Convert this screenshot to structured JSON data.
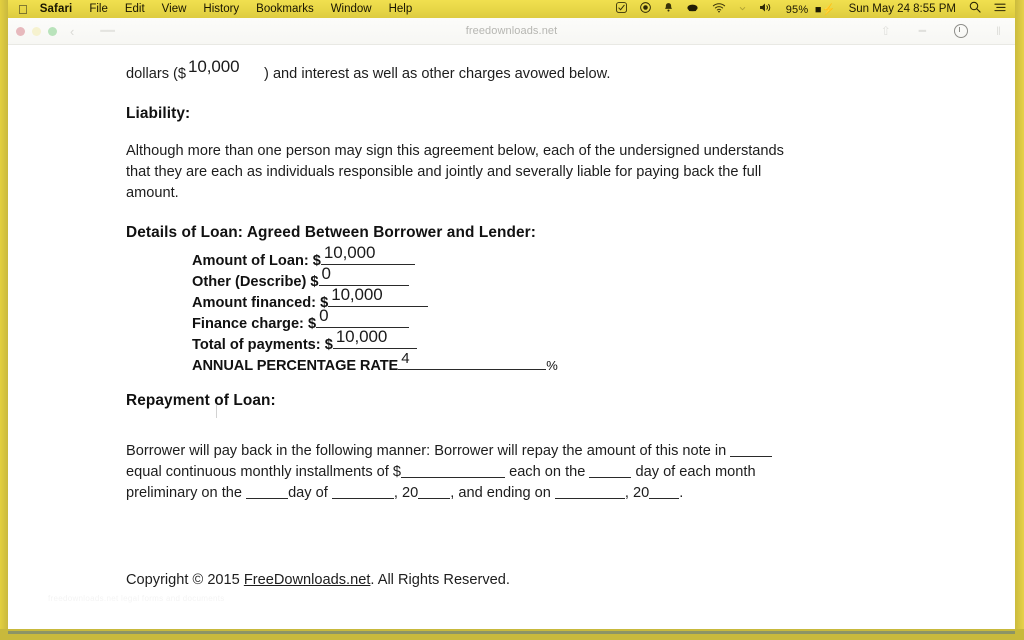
{
  "menubar": {
    "apple_icon": "apple-icon",
    "items": [
      {
        "label": "Safari",
        "bold": true
      },
      {
        "label": "File",
        "bold": false
      },
      {
        "label": "Edit",
        "bold": false
      },
      {
        "label": "View",
        "bold": false
      },
      {
        "label": "History",
        "bold": false
      },
      {
        "label": "Bookmarks",
        "bold": false
      },
      {
        "label": "Window",
        "bold": false
      },
      {
        "label": "Help",
        "bold": false
      }
    ],
    "status_icons": [
      "checkbox-checked-icon",
      "record-dot-icon",
      "bell-icon",
      "dropbox-icon",
      "wifi-icon",
      "chevron-small-icon",
      "volume-icon"
    ],
    "battery": "95%",
    "battery_icon": "battery-charging-icon",
    "clock": "Sun May 24  8:55 PM",
    "search_icon": "search-icon",
    "notification_center_icon": "list-lines-icon"
  },
  "browser": {
    "window_title": "freedownloads.net",
    "traffic_lights": [
      "close-button",
      "minimize-button",
      "zoom-button"
    ],
    "back_icon": "back-arrow-icon",
    "share_icon": "share-icon",
    "tabs_icon": "show-tabs-icon",
    "settings_icon": "gear-icon"
  },
  "document": {
    "line_top": "dollars ($__________) and interest as well as other charges avowed below.",
    "line_top_filled": "10,000",
    "liability_heading": "Liability:",
    "liability_body_lines": [
      "Although more than one person may sign this agreement below, each of the undersigned understands",
      "that they are each as individuals responsible and jointly and severally liable for paying back the full",
      "amount."
    ],
    "details_heading": "Details of Loan: Agreed Between Borrower and Lender:",
    "fields": [
      {
        "label": "Amount of Loan: $",
        "value": "10,000"
      },
      {
        "label": "Other (Describe) $",
        "value": "0"
      },
      {
        "label": "Amount financed: $",
        "value": "10,000"
      },
      {
        "label": "Finance charge: $",
        "value": "0"
      },
      {
        "label": "Total of payments: $",
        "value": "10,000"
      }
    ],
    "apr_label": "ANNUAL PERCENTAGE RATE",
    "apr_value": "4",
    "apr_suffix": "%",
    "repayment_heading": "Repayment of Loan:",
    "repayment_line1_a": "Borrower will pay back in the following manner: Borrower will repay the amount of this note in",
    "repayment_line2_a": "equal continuous monthly installments of $",
    "repayment_line2_b": "each on the",
    "repayment_line2_c": "day of each month",
    "repayment_line3_a": "preliminary on the",
    "repayment_line3_b": "day of",
    "repayment_line3_c": ", 20",
    "repayment_line3_d": ", and ending on",
    "repayment_line3_e": ", 20",
    "repayment_line3_f": ".",
    "copyright_prefix": "Copyright © 2015 ",
    "copyright_link": "FreeDownloads.net",
    "copyright_suffix": ". All Rights Reserved.",
    "watermark": "freedownloads.net legal forms and documents"
  },
  "colors": {
    "frame": "#ddcb40",
    "menubar": "#e7d646",
    "page": "#ffffff",
    "text": "#1d1d1d"
  }
}
